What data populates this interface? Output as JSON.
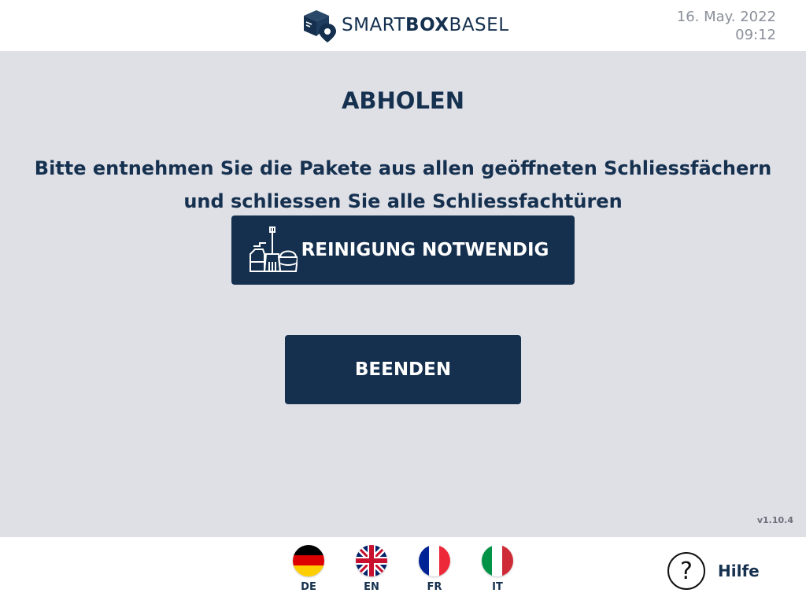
{
  "header": {
    "logo": {
      "text_light_1": "SMART",
      "text_bold": "BOX",
      "text_light_2": "BASEL",
      "icon": "package-location-icon"
    },
    "date": "16. May. 2022",
    "time": "09:12"
  },
  "main": {
    "title": "ABHOLEN",
    "instruction": "Bitte entnehmen Sie die Pakete aus allen geöffneten Schliessfächern und schliessen Sie alle Schliessfachtüren",
    "clean_button": {
      "label": "REINIGUNG NOTWENDIG",
      "icon": "cleaning-supplies-icon"
    },
    "end_button": {
      "label": "BEENDEN"
    },
    "version": "v1.10.4"
  },
  "footer": {
    "languages": [
      {
        "code": "DE",
        "icon": "germany-flag-icon"
      },
      {
        "code": "EN",
        "icon": "uk-flag-icon"
      },
      {
        "code": "FR",
        "icon": "france-flag-icon"
      },
      {
        "code": "IT",
        "icon": "italy-flag-icon"
      }
    ],
    "help": {
      "label": "Hilfe",
      "symbol": "?",
      "icon": "question-mark-icon"
    }
  },
  "colors": {
    "primary": "#15304f",
    "background": "#dfdfe6",
    "header_bg": "#ffffff",
    "muted_text": "#8a8f99"
  }
}
